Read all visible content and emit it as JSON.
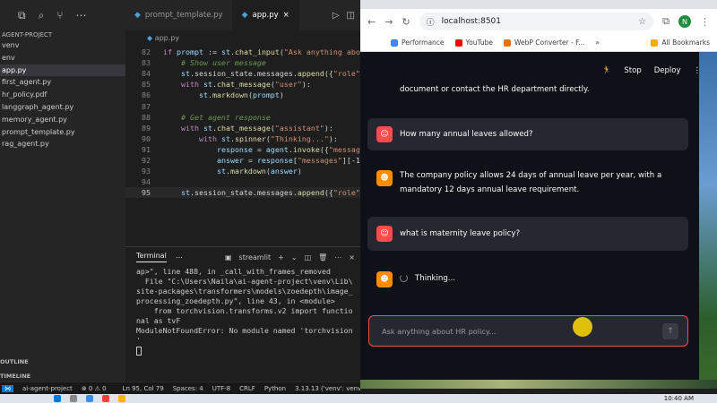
{
  "vscode": {
    "tabs": [
      {
        "label": "prompt_template.py",
        "active": false
      },
      {
        "label": "app.py",
        "active": true
      }
    ],
    "breadcrumb": "app.py",
    "explorer": {
      "project": "AGENT-PROJECT",
      "files": [
        "venv",
        "env",
        "app.py",
        "first_agent.py",
        "hr_policy.pdf",
        "langgraph_agent.py",
        "memory_agent.py",
        "prompt_template.py",
        "rag_agent.py"
      ],
      "active_file": "app.py",
      "bottom_labels": [
        "OUTLINE",
        "TIMELINE"
      ]
    },
    "code_lines": [
      {
        "n": "82",
        "text": "if prompt := st.chat_input(\"Ask anything abou"
      },
      {
        "n": "83",
        "text": "    # Show user message"
      },
      {
        "n": "84",
        "text": "    st.session_state.messages.append({\"role\":"
      },
      {
        "n": "85",
        "text": "    with st.chat_message(\"user\"):"
      },
      {
        "n": "86",
        "text": "        st.markdown(prompt)"
      },
      {
        "n": "87",
        "text": ""
      },
      {
        "n": "88",
        "text": "    # Get agent response"
      },
      {
        "n": "89",
        "text": "    with st.chat_message(\"assistant\"):"
      },
      {
        "n": "90",
        "text": "        with st.spinner(\"Thinking...\"):"
      },
      {
        "n": "91",
        "text": "            response = agent.invoke({\"message"
      },
      {
        "n": "92",
        "text": "            answer = response[\"messages\"][-1]"
      },
      {
        "n": "93",
        "text": "            st.markdown(answer)"
      },
      {
        "n": "94",
        "text": ""
      },
      {
        "n": "95",
        "text": "    st.session_state.messages.append({\"role\":"
      }
    ],
    "terminal": {
      "tab_label": "Terminal",
      "shell_label": "streamlit",
      "lines": [
        "ap>\", line 488, in _call_with_frames_removed",
        "  File \"C:\\Users\\Naila\\ai-agent-project\\venv\\Lib\\",
        "site-packages\\transformers\\models\\zoedepth\\image_",
        "processing_zoedepth.py\", line 43, in <module>",
        "    from torchvision.transforms.v2 import functio",
        "nal as tvF",
        "ModuleNotFoundError: No module named 'torchvision",
        "'"
      ]
    },
    "statusbar": {
      "project": "ai-agent-project",
      "problems": "⊗ 0 ⚠ 0",
      "position": "Ln 95, Col 79",
      "spaces": "Spaces: 4",
      "encoding": "UTF-8",
      "eol": "CRLF",
      "language": "Python",
      "interpreter": "3.13.13 ('venv': venv)"
    }
  },
  "browser": {
    "url": "localhost:8501",
    "profile_initial": "N",
    "bookmarks": [
      "Performance",
      "YouTube",
      "WebP Converter - F..."
    ],
    "all_bookmarks": "All Bookmarks"
  },
  "app": {
    "header": {
      "stop": "Stop",
      "deploy": "Deploy"
    },
    "messages": [
      {
        "role": "assistant",
        "text": "document or contact the HR department directly."
      },
      {
        "role": "user",
        "text": "How many annual leaves allowed?"
      },
      {
        "role": "assistant",
        "text": "The company policy allows 24 days of annual leave per year, with a mandatory 12 days annual leave requirement."
      },
      {
        "role": "user",
        "text": "what is maternity leave policy?"
      },
      {
        "role": "assistant",
        "text": "Thinking..."
      }
    ],
    "chat_input": {
      "placeholder": "Ask anything about HR policy..."
    }
  },
  "taskbar": {
    "time": "10:40 AM"
  },
  "colors": {
    "accent": "#ff4b4b",
    "assistant_avatar": "#ff8c00",
    "app_bg": "#0e1117",
    "user_bubble": "#262730"
  }
}
